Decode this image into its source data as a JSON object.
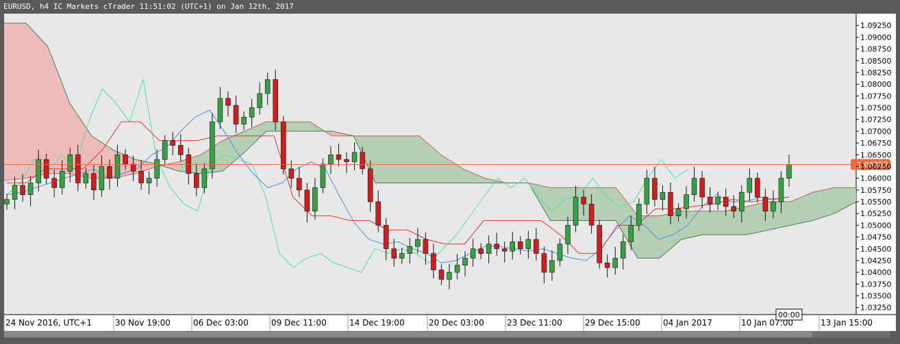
{
  "window": {
    "title": "EURUSD, h4 IC Markets cTrader 11:51:02 (UTC+1) on Jan 12th, 2017"
  },
  "colors": {
    "background": "#e8e8e8",
    "chrome": "#5a5a5a",
    "bull": "#3aa047",
    "bear": "#cc1f1f",
    "price_line": "#f06a3c",
    "tenkan": "#4d8fe0",
    "kijun": "#e03535",
    "chikou": "#4fe0a0",
    "cloud_bear": "#f0b0b0",
    "cloud_bull": "#a8c8a8",
    "cloud_mixed": "#cfa8a0"
  },
  "chart_data": {
    "type": "candlestick",
    "symbol": "EURUSD",
    "timeframe": "h4",
    "current_price": "1.06292",
    "cursor_time": "00:00",
    "ylim": [
      1.031,
      1.095
    ],
    "y_ticks": [
      "1.09250",
      "1.09000",
      "1.08750",
      "1.08500",
      "1.08250",
      "1.08000",
      "1.07750",
      "1.07500",
      "1.07250",
      "1.07000",
      "1.06750",
      "1.06500",
      "1.06250",
      "1.06000",
      "1.05750",
      "1.05500",
      "1.05250",
      "1.05000",
      "1.04750",
      "1.04500",
      "1.04250",
      "1.04000",
      "1.03750",
      "1.03500",
      "1.03250"
    ],
    "x_labels": [
      "24 Nov 2016, UTC+1",
      "30 Nov 19:00",
      "06 Dec 03:00",
      "09 Dec 11:00",
      "14 Dec 19:00",
      "20 Dec 03:00",
      "23 Dec 11:00",
      "29 Dec 15:00",
      "04 Jan 2017",
      "10 Jan 07:00",
      "13 Jan 15:00"
    ],
    "closes": [
      1.0555,
      1.0585,
      1.0565,
      1.059,
      1.064,
      1.06,
      1.058,
      1.0615,
      1.065,
      1.059,
      1.061,
      1.0575,
      1.0625,
      1.06,
      1.065,
      1.063,
      1.0615,
      1.059,
      1.06,
      1.064,
      1.068,
      1.067,
      1.065,
      1.061,
      1.058,
      1.062,
      1.072,
      1.077,
      1.0755,
      1.0715,
      1.073,
      1.075,
      1.078,
      1.081,
      1.072,
      1.062,
      1.06,
      1.0575,
      1.053,
      1.058,
      1.063,
      1.065,
      1.064,
      1.0635,
      1.0655,
      1.062,
      1.055,
      1.05,
      1.045,
      1.043,
      1.044,
      1.0455,
      1.047,
      1.044,
      1.0405,
      1.0385,
      1.04,
      1.0415,
      1.043,
      1.045,
      1.044,
      1.046,
      1.045,
      1.0445,
      1.0465,
      1.045,
      1.047,
      1.044,
      1.04,
      1.0425,
      1.046,
      1.05,
      1.056,
      1.0545,
      1.05,
      1.042,
      1.041,
      1.043,
      1.0465,
      1.05,
      1.0545,
      1.06,
      1.0555,
      1.057,
      1.052,
      1.0535,
      1.0565,
      1.06,
      1.056,
      1.0545,
      1.056,
      1.054,
      1.053,
      1.057,
      1.06,
      1.056,
      1.053,
      1.055,
      1.06,
      1.0629
    ],
    "tenkan": [
      1.0565,
      1.057,
      1.058,
      1.059,
      1.06,
      1.061,
      1.062,
      1.06,
      1.061,
      1.062,
      1.065,
      1.0665,
      1.07,
      1.073,
      1.0745,
      1.07,
      1.065,
      1.061,
      1.058,
      1.059,
      1.062,
      1.0635,
      1.062,
      1.056,
      1.0505,
      1.047,
      1.046,
      1.0465,
      1.045,
      1.044,
      1.042,
      1.0425,
      1.044,
      1.0455,
      1.0455,
      1.045,
      1.0445,
      1.045,
      1.044,
      1.043,
      1.0425,
      1.045,
      1.049,
      1.052,
      1.05,
      1.047,
      1.048,
      1.05,
      1.054,
      1.0565,
      1.055,
      1.055,
      1.056,
      1.0555,
      1.056
    ],
    "kijun": [
      1.059,
      1.059,
      1.062,
      1.062,
      1.062,
      1.066,
      1.072,
      1.072,
      1.068,
      1.068,
      1.068,
      1.069,
      1.069,
      1.069,
      1.069,
      1.056,
      1.052,
      1.052,
      1.051,
      1.051,
      1.049,
      1.049,
      1.047,
      1.046,
      1.046,
      1.051,
      1.051,
      1.051,
      1.051,
      1.048,
      1.044,
      1.044,
      1.05,
      1.05,
      1.0535,
      1.0535,
      1.054,
      1.0545,
      1.0555,
      1.055,
      1.0555,
      1.056
    ],
    "chikou": [
      1.0565,
      1.059,
      1.064,
      1.061,
      1.065,
      1.062,
      1.072,
      1.079,
      1.076,
      1.072,
      1.081,
      1.064,
      1.058,
      1.0545,
      1.053,
      1.063,
      1.065,
      1.064,
      1.063,
      1.056,
      1.044,
      1.041,
      1.043,
      1.044,
      1.042,
      1.041,
      1.04,
      1.045,
      1.044,
      1.045,
      1.044,
      1.042,
      1.045,
      1.048,
      1.052,
      1.056,
      1.06,
      1.058,
      1.06,
      1.056,
      1.053,
      1.0555,
      1.0565,
      1.06,
      1.056,
      1.054,
      1.055,
      1.06,
      1.064,
      1.06,
      1.062
    ],
    "senkou_a": [
      1.0595,
      1.06,
      1.061,
      1.061,
      1.06,
      1.06,
      1.061,
      1.0625,
      1.0635,
      1.065,
      1.068,
      1.07,
      1.072,
      1.072,
      1.072,
      1.069,
      1.069,
      1.069,
      1.069,
      1.069,
      1.065,
      1.062,
      1.06,
      1.059,
      1.059,
      1.058,
      1.058,
      1.058,
      1.058,
      1.052,
      1.052,
      1.053,
      1.053,
      1.053,
      1.054,
      1.055,
      1.055,
      1.057,
      1.058,
      1.058
    ],
    "senkou_b": [
      1.093,
      1.093,
      1.088,
      1.076,
      1.069,
      1.066,
      1.064,
      1.063,
      1.0615,
      1.061,
      1.0615,
      1.0655,
      1.07,
      1.07,
      1.07,
      1.07,
      1.069,
      1.059,
      1.059,
      1.059,
      1.059,
      1.059,
      1.059,
      1.059,
      1.059,
      1.051,
      1.051,
      1.051,
      1.051,
      1.043,
      1.043,
      1.047,
      1.048,
      1.048,
      1.048,
      1.049,
      1.05,
      1.051,
      1.0525,
      1.055
    ]
  }
}
